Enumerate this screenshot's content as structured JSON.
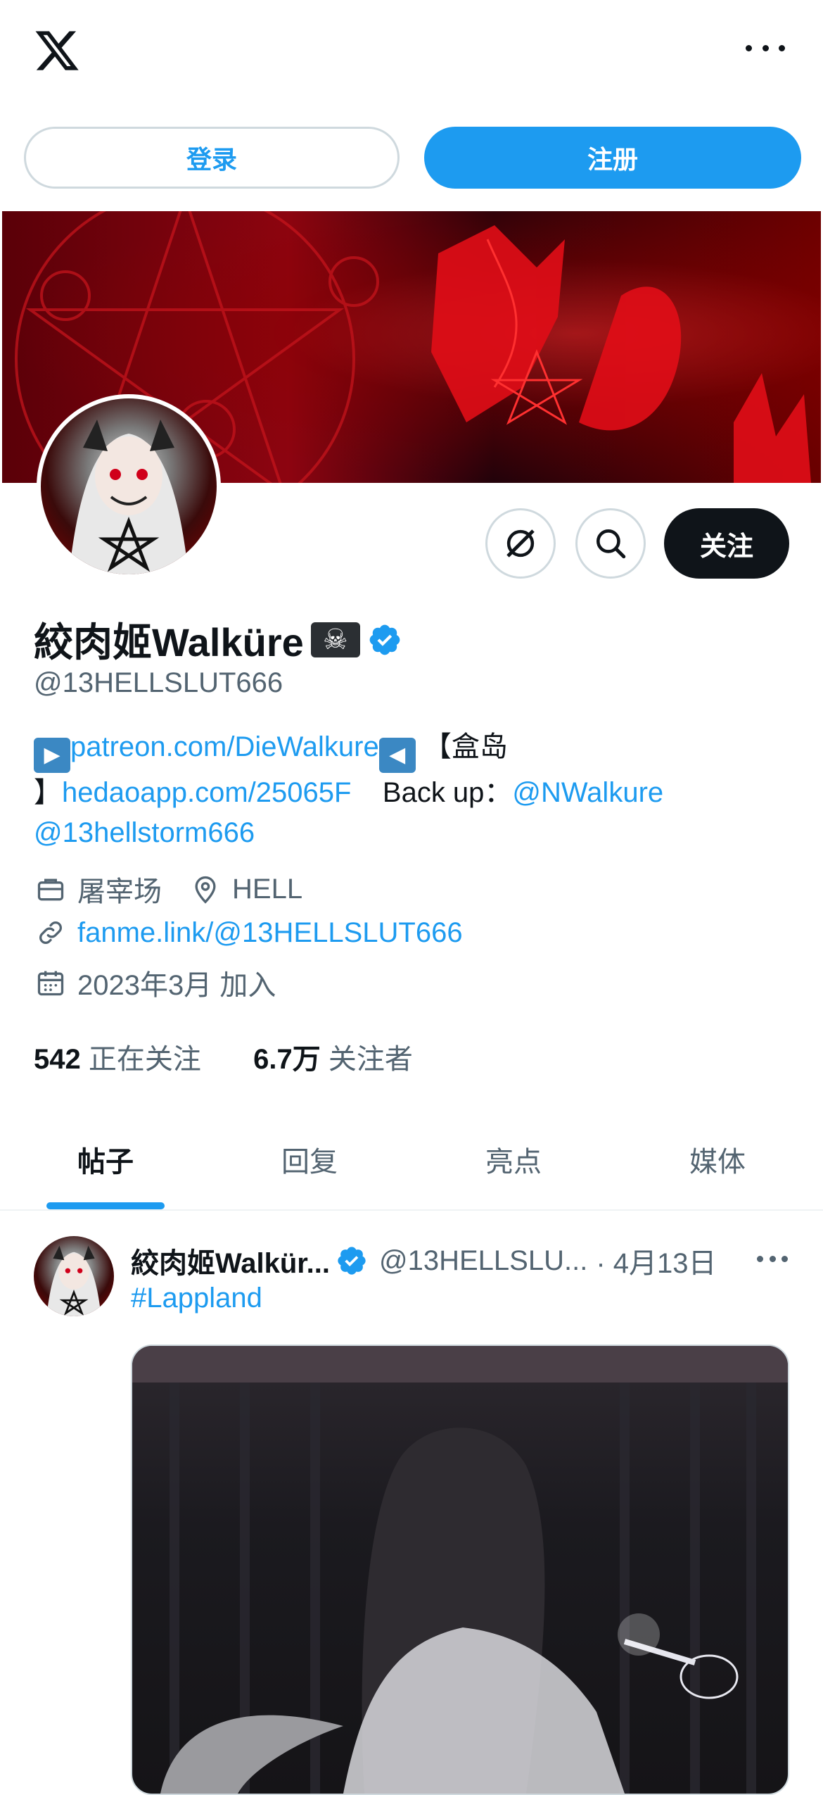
{
  "top_bar": {
    "logo_icon": "x-logo-icon",
    "more_icon": "more-horizontal-icon"
  },
  "auth": {
    "login_label": "登录",
    "signup_label": "注册"
  },
  "profile": {
    "display_name": "絞肉姬Walküre",
    "name_emoji": "☠",
    "verified": true,
    "handle": "@13HELLSLUT666",
    "follow_label": "关注",
    "bio": {
      "play_right": "▶",
      "link1": "patreon.com/DieWalkure",
      "play_left": "◀",
      "text_box_open": "【盒岛",
      "text_box_close": "】",
      "link2": "hedaoapp.com/25065F",
      "backup_label": "Back up：",
      "mention1": "@NWalkure",
      "mention2": "@13hellstorm666"
    },
    "category": "屠宰场",
    "location": "HELL",
    "website": "fanme.link/@13HELLSLUT666",
    "joined": "2023年3月 加入",
    "following_count": "542",
    "following_label": "正在关注",
    "followers_count": "6.7万",
    "followers_label": "关注者"
  },
  "tabs": [
    {
      "label": "帖子",
      "active": true
    },
    {
      "label": "回复",
      "active": false
    },
    {
      "label": "亮点",
      "active": false
    },
    {
      "label": "媒体",
      "active": false
    }
  ],
  "post": {
    "author_name": "絞肉姬Walkür...",
    "author_handle": "@13HELLSLU...",
    "date": "· 4月13日",
    "hashtag": "#Lappland"
  },
  "colors": {
    "accent": "#1d9bf0",
    "text_primary": "#0f1419",
    "text_secondary": "#536471",
    "border": "#cfd9de"
  }
}
